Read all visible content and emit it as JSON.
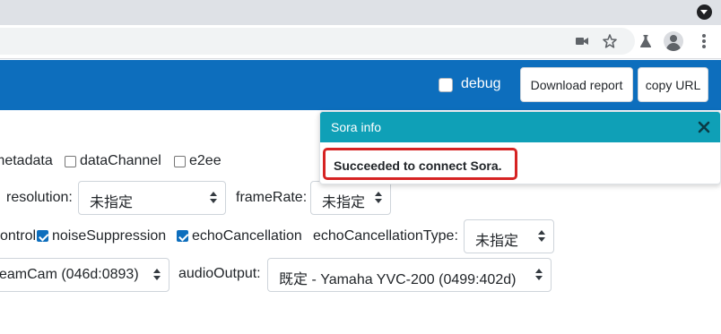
{
  "browser": {
    "toolbar_icons": [
      "camera-icon",
      "star-icon",
      "labs-flask-icon",
      "profile-icon",
      "more-vert-icon"
    ]
  },
  "navbar": {
    "debug_label": "debug",
    "debug_checked": false,
    "download_report_label": "Download report",
    "copy_url_label": "copy URL",
    "background_color": "#0d6ebd"
  },
  "options": {
    "metadata_label": "metadata",
    "datachannel_label": "dataChannel",
    "e2ee_label": "e2ee",
    "resolution_label": "resolution:",
    "resolution_value": "未指定",
    "framerate_label": "frameRate:",
    "framerate_value": "未指定",
    "control_label": "control",
    "noise_label": "noiseSuppression",
    "echo_label": "echoCancellation",
    "echo_type_label": "echoCancellationType:",
    "echo_type_value": "未指定",
    "video_input_value": "eamCam (046d:0893)",
    "audio_output_label": "audioOutput:",
    "audio_output_value": "既定 - Yamaha YVC-200 (0499:402d)"
  },
  "toast": {
    "title": "Sora info",
    "message": "Succeeded to connect Sora.",
    "header_color": "#0fa0b7",
    "highlight_color": "#d62323"
  }
}
